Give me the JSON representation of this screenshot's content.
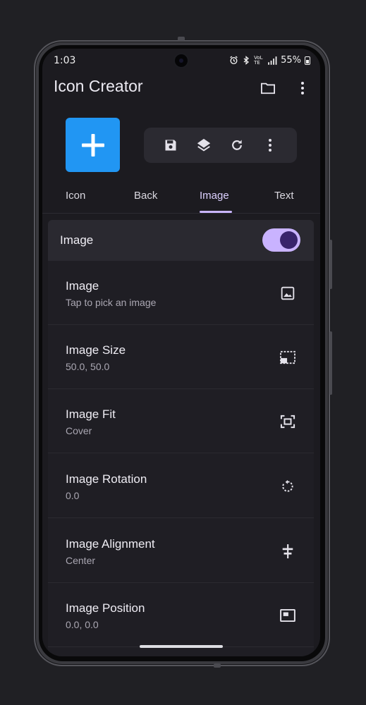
{
  "status": {
    "time": "1:03",
    "network": "VoLTE",
    "battery": "55%"
  },
  "app": {
    "title": "Icon Creator"
  },
  "tabs": [
    {
      "label": "Icon"
    },
    {
      "label": "Back"
    },
    {
      "label": "Image"
    },
    {
      "label": "Text"
    }
  ],
  "active_tab": "Image",
  "toggle": {
    "label": "Image",
    "on": true
  },
  "settings": [
    {
      "title": "Image",
      "subtitle": "Tap to pick an image",
      "icon": "image-icon"
    },
    {
      "title": "Image Size",
      "subtitle": "50.0, 50.0",
      "icon": "resize-icon"
    },
    {
      "title": "Image Fit",
      "subtitle": "Cover",
      "icon": "fit-icon"
    },
    {
      "title": "Image Rotation",
      "subtitle": "0.0",
      "icon": "rotate-icon"
    },
    {
      "title": "Image Alignment",
      "subtitle": "Center",
      "icon": "align-center-icon"
    },
    {
      "title": "Image Position",
      "subtitle": "0.0, 0.0",
      "icon": "position-icon"
    }
  ],
  "colors": {
    "accent": "#c9b5ff",
    "preview_bg": "#2196f3",
    "background": "#1c1b20"
  }
}
